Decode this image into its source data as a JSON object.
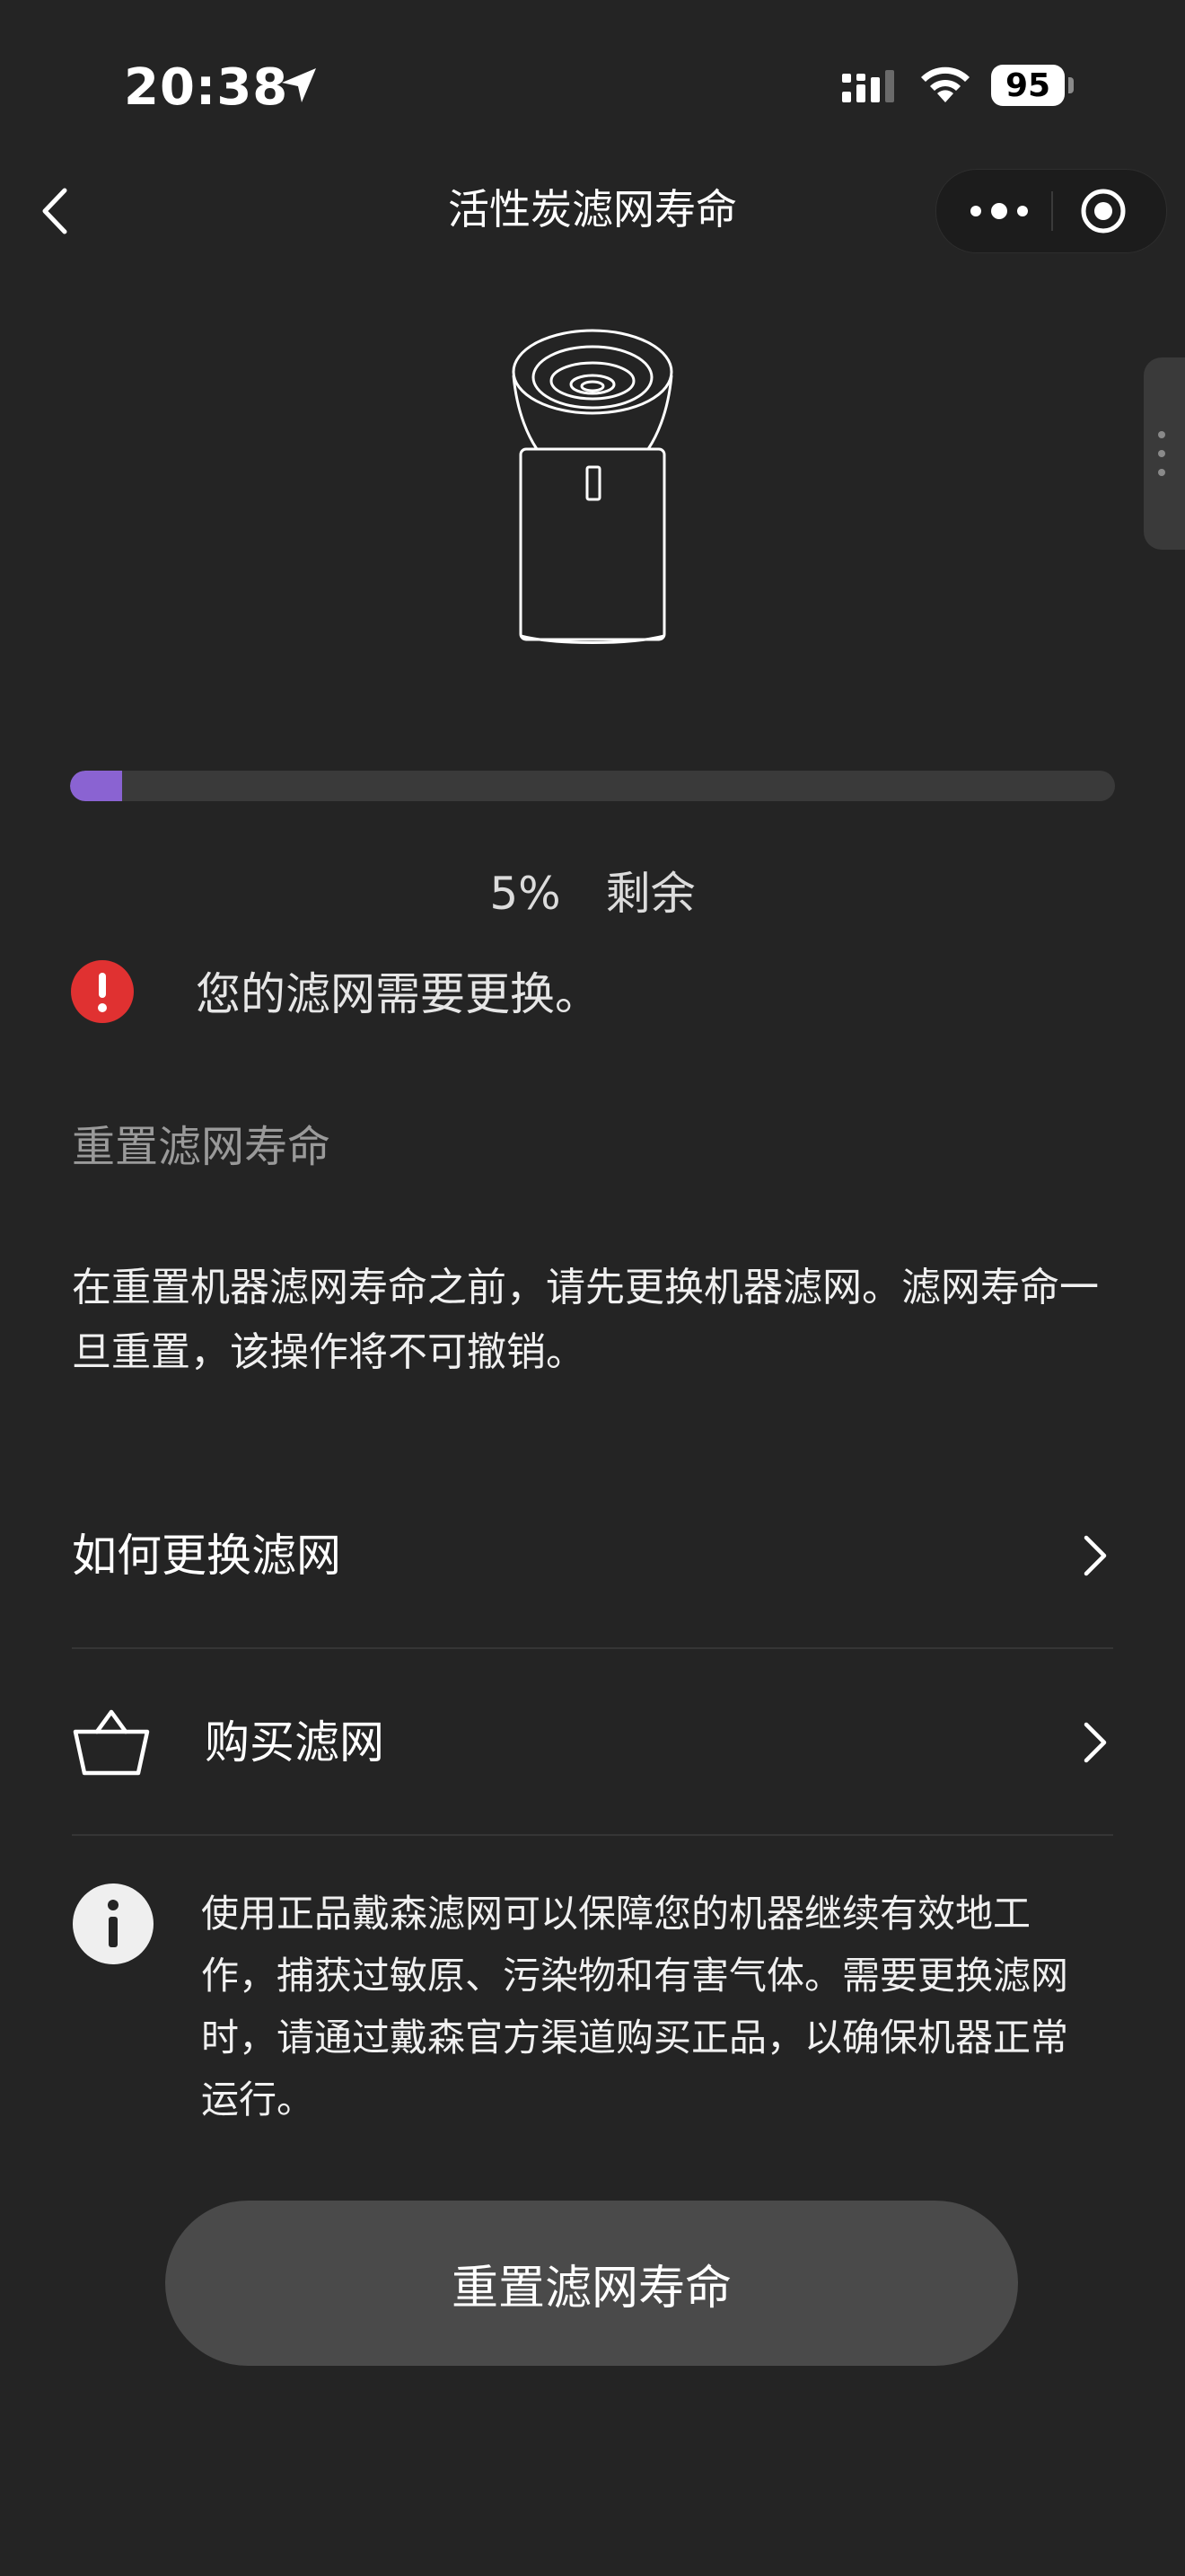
{
  "status_bar": {
    "time": "20:38",
    "battery": "95",
    "icons": [
      "location-arrow-icon",
      "cellular-signal-icon",
      "wifi-icon",
      "battery-icon"
    ]
  },
  "nav": {
    "title": "活性炭滤网寿命",
    "back_icon": "chevron-left-icon",
    "more_icon": "more-dots-icon",
    "close_icon": "target-close-icon"
  },
  "filter": {
    "remaining_percent": 5,
    "remaining_value": "5%",
    "remaining_label": "剩余",
    "progress_color": "#8a63d2"
  },
  "alert": {
    "icon": "exclamation-icon",
    "color": "#e03131",
    "text": "您的滤网需要更换。"
  },
  "reset_section": {
    "title": "重置滤网寿命",
    "description": "在重置机器滤网寿命之前，请先更换机器滤网。滤网寿命一旦重置，该操作将不可撤销。"
  },
  "list": {
    "how_to_replace": "如何更换滤网",
    "buy_filter": "购买滤网"
  },
  "info": {
    "icon": "info-icon",
    "text": "使用正品戴森滤网可以保障您的机器继续有效地工作，捕获过敏原、污染物和有害气体。需要更换滤网时，请通过戴森官方渠道购买正品，以确保机器正常运行。"
  },
  "button": {
    "reset_label": "重置滤网寿命"
  }
}
